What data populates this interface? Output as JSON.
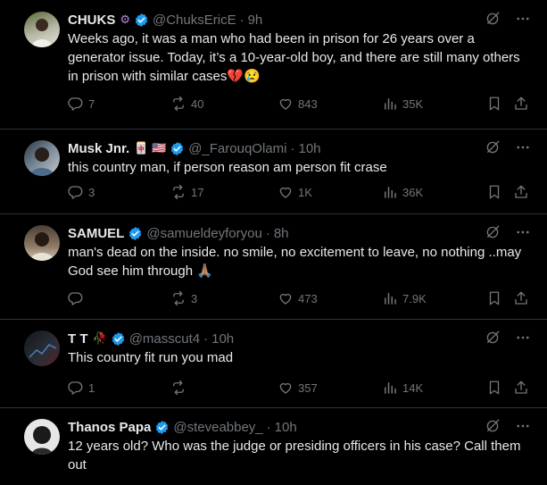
{
  "tweets": [
    {
      "name": "CHUKS",
      "badge": "⚙",
      "handle": "@ChuksEricE",
      "time": "9h",
      "text": "Weeks ago, it was a man who had been in prison for 26 years over a generator issue. Today, it’s a 10-year-old boy, and there are still many others in prison with similar cases💔😢",
      "replies": "7",
      "reposts": "40",
      "likes": "843",
      "views": "35K"
    },
    {
      "name": "Musk Jnr.",
      "badge": "🀄 🇺🇸",
      "handle": "@_FarouqOlami",
      "time": "10h",
      "text": "this country man, if person reason am person fit crase",
      "replies": "3",
      "reposts": "17",
      "likes": "1K",
      "views": "36K"
    },
    {
      "name": "SAMUEL",
      "badge": "",
      "handle": "@samueldeyforyou",
      "time": "8h",
      "text": "man's dead on the inside.  no smile, no excitement to leave, no nothing ..may God see him through 🙏🏽",
      "replies": "",
      "reposts": "3",
      "likes": "473",
      "views": "7.9K"
    },
    {
      "name": "T T",
      "badge": "🥀",
      "handle": "@masscut4",
      "time": "10h",
      "text": "This country fit run you mad",
      "replies": "1",
      "reposts": "",
      "likes": "357",
      "views": "14K"
    },
    {
      "name": "Thanos Papa",
      "badge": "",
      "handle": "@steveabbey_",
      "time": "10h",
      "text": "12 years old? Who was the judge or presiding officers in his case? Call them out",
      "replies": "",
      "reposts": "",
      "likes": "",
      "views": ""
    }
  ],
  "colors": {
    "background": "#000000",
    "text": "#e7e9ea",
    "muted": "#71767b",
    "verified": "#1d9bf0",
    "divider": "#2f3336"
  }
}
